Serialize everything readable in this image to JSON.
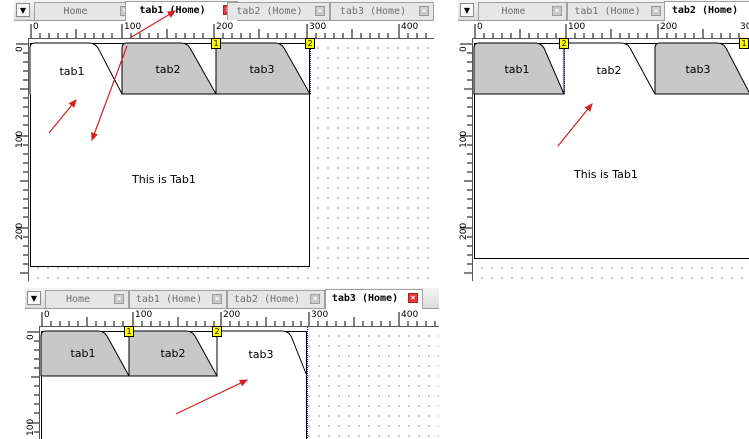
{
  "tab_strip_names": [
    "Home",
    "tab1 (Home)",
    "tab2 (Home)",
    "tab3 (Home)"
  ],
  "ruler": {
    "h_labels": [
      "0",
      "100",
      "200",
      "300",
      "400"
    ],
    "v_labels": [
      "0",
      "100",
      "200"
    ]
  },
  "panels": [
    {
      "active_tab": "tab1 (Home)",
      "component_tabs": [
        "tab1",
        "tab2",
        "tab3"
      ],
      "selected_component_tab": "tab1",
      "content_text": "This is Tab1",
      "markers": [
        "1",
        "2"
      ]
    },
    {
      "active_tab": "tab2 (Home)",
      "component_tabs": [
        "tab1",
        "tab2",
        "tab3"
      ],
      "selected_component_tab": "tab2",
      "content_text": "This is Tab1",
      "markers": [
        "2",
        "1"
      ]
    },
    {
      "active_tab": "tab3 (Home)",
      "component_tabs": [
        "tab1",
        "tab2",
        "tab3"
      ],
      "selected_component_tab": "tab3",
      "content_text": "",
      "markers": [
        "1",
        "2"
      ]
    }
  ],
  "colors": {
    "annotation_arrow": "#d42020",
    "inactive_tab_fill": "#c8c8c8",
    "marker_fill": "#ffff00"
  }
}
